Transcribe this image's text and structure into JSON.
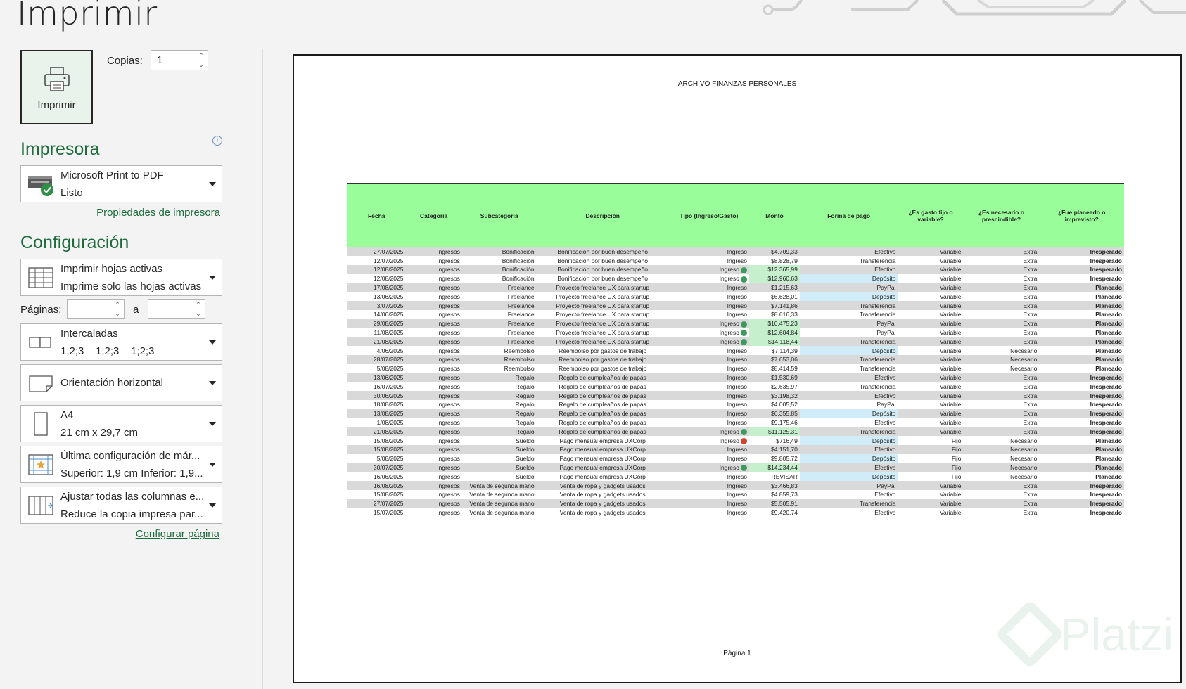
{
  "title": "Imprimir",
  "print_button": {
    "label": "Imprimir",
    "icon": "printer-icon"
  },
  "copies": {
    "label": "Copias:",
    "value": "1"
  },
  "printer_section": {
    "heading": "Impresora",
    "name": "Microsoft Print to PDF",
    "status": "Listo",
    "properties_link": "Propiedades de impresora"
  },
  "config_section": {
    "heading": "Configuración",
    "what": {
      "line1": "Imprimir hojas activas",
      "line2": "Imprime solo las hojas activas"
    },
    "pages_label": "Páginas:",
    "pages_to": "a",
    "pages_from_value": "",
    "pages_to_value": "",
    "collate": {
      "line1": "Intercaladas",
      "line2": "1;2;3    1;2;3    1;2;3"
    },
    "orientation": {
      "line1": "Orientación horizontal"
    },
    "paper": {
      "line1": "A4",
      "line2": "21 cm x 29,7 cm"
    },
    "margins": {
      "line1": "Última configuración de már...",
      "line2": "Superior: 1,9 cm Inferior: 1,9..."
    },
    "scaling": {
      "line1": "Ajustar todas las columnas e...",
      "line2": "Reduce la copia impresa par..."
    },
    "page_setup_link": "Configurar página"
  },
  "preview": {
    "doc_title": "ARCHIVO FINANZAS PERSONALES",
    "page_label": "Página 1",
    "columns": [
      "Fecha",
      "Categoría",
      "Subcategoría",
      "Descripción",
      "Tipo (Ingreso/Gasto)",
      "Monto",
      "Forma de pago",
      "¿Es gasto fijo o variable?",
      "¿Es necesario o prescindible?",
      "¿Fue planeado o imprevisto?"
    ],
    "rows": [
      {
        "fecha": "27/07/2025",
        "cat": "Ingresos",
        "sub": "Bonificación",
        "desc": "Bonificación por buen desempeño",
        "tipo": "Ingreso",
        "monto": "$4.709,33",
        "pago": "Efectivo",
        "fijo": "Variable",
        "nec": "Extra",
        "plan": "Inesperado",
        "status": "",
        "hl": ""
      },
      {
        "fecha": "12/07/2025",
        "cat": "Ingresos",
        "sub": "Bonificación",
        "desc": "Bonificación por buen desempeño",
        "tipo": "Ingreso",
        "monto": "$8.828,79",
        "pago": "Transferencia",
        "fijo": "Variable",
        "nec": "Extra",
        "plan": "Inesperado",
        "status": "",
        "hl": ""
      },
      {
        "fecha": "12/08/2025",
        "cat": "Ingresos",
        "sub": "Bonificación",
        "desc": "Bonificación por buen desempeño",
        "tipo": "Ingreso",
        "monto": "$12.365,99",
        "pago": "Efectivo",
        "fijo": "Variable",
        "nec": "Extra",
        "plan": "Inesperado",
        "status": "ok",
        "hl": "mg"
      },
      {
        "fecha": "12/08/2025",
        "cat": "Ingresos",
        "sub": "Bonificación",
        "desc": "Bonificación por buen desempeño",
        "tipo": "Ingreso",
        "monto": "$12.960,63",
        "pago": "Depósito",
        "fijo": "Variable",
        "nec": "Extra",
        "plan": "Inesperado",
        "status": "ok",
        "hl": "mg"
      },
      {
        "fecha": "17/08/2025",
        "cat": "Ingresos",
        "sub": "Freelance",
        "desc": "Proyecto freelance UX para startup",
        "tipo": "Ingreso",
        "monto": "$1.215,63",
        "pago": "PayPal",
        "fijo": "Variable",
        "nec": "Extra",
        "plan": "Planeado",
        "status": "",
        "hl": ""
      },
      {
        "fecha": "13/06/2025",
        "cat": "Ingresos",
        "sub": "Freelance",
        "desc": "Proyecto freelance UX para startup",
        "tipo": "Ingreso",
        "monto": "$6.628,01",
        "pago": "Depósito",
        "fijo": "Variable",
        "nec": "Extra",
        "plan": "Planeado",
        "status": "",
        "hl": ""
      },
      {
        "fecha": "3/07/2025",
        "cat": "Ingresos",
        "sub": "Freelance",
        "desc": "Proyecto freelance UX para startup",
        "tipo": "Ingreso",
        "monto": "$7.141,86",
        "pago": "Transferencia",
        "fijo": "Variable",
        "nec": "Extra",
        "plan": "Planeado",
        "status": "",
        "hl": ""
      },
      {
        "fecha": "14/06/2025",
        "cat": "Ingresos",
        "sub": "Freelance",
        "desc": "Proyecto freelance UX para startup",
        "tipo": "Ingreso",
        "monto": "$8.616,33",
        "pago": "Transferencia",
        "fijo": "Variable",
        "nec": "Extra",
        "plan": "Planeado",
        "status": "",
        "hl": ""
      },
      {
        "fecha": "29/08/2025",
        "cat": "Ingresos",
        "sub": "Freelance",
        "desc": "Proyecto freelance UX para startup",
        "tipo": "Ingreso",
        "monto": "$10.475,23",
        "pago": "PayPal",
        "fijo": "Variable",
        "nec": "Extra",
        "plan": "Planeado",
        "status": "ok",
        "hl": "mg"
      },
      {
        "fecha": "11/08/2025",
        "cat": "Ingresos",
        "sub": "Freelance",
        "desc": "Proyecto freelance UX para startup",
        "tipo": "Ingreso",
        "monto": "$12.604,84",
        "pago": "PayPal",
        "fijo": "Variable",
        "nec": "Extra",
        "plan": "Planeado",
        "status": "ok",
        "hl": "mg"
      },
      {
        "fecha": "21/08/2025",
        "cat": "Ingresos",
        "sub": "Freelance",
        "desc": "Proyecto freelance UX para startup",
        "tipo": "Ingreso",
        "monto": "$14.118,44",
        "pago": "Transferencia",
        "fijo": "Variable",
        "nec": "Extra",
        "plan": "Planeado",
        "status": "ok",
        "hl": "mg"
      },
      {
        "fecha": "4/06/2025",
        "cat": "Ingresos",
        "sub": "Reembolso",
        "desc": "Reembolso por gastos de trabajo",
        "tipo": "Ingreso",
        "monto": "$7.114,39",
        "pago": "Depósito",
        "fijo": "Variable",
        "nec": "Necesario",
        "plan": "Planeado",
        "status": "",
        "hl": ""
      },
      {
        "fecha": "28/07/2025",
        "cat": "Ingresos",
        "sub": "Reembolso",
        "desc": "Reembolso por gastos de trabajo",
        "tipo": "Ingreso",
        "monto": "$7.653,06",
        "pago": "Transferencia",
        "fijo": "Variable",
        "nec": "Necesario",
        "plan": "Planeado",
        "status": "",
        "hl": ""
      },
      {
        "fecha": "5/08/2025",
        "cat": "Ingresos",
        "sub": "Reembolso",
        "desc": "Reembolso por gastos de trabajo",
        "tipo": "Ingreso",
        "monto": "$8.414,59",
        "pago": "Transferencia",
        "fijo": "Variable",
        "nec": "Necesario",
        "plan": "Planeado",
        "status": "",
        "hl": ""
      },
      {
        "fecha": "13/06/2025",
        "cat": "Ingresos",
        "sub": "Regalo",
        "desc": "Regalo de cumpleaños de papás",
        "tipo": "Ingreso",
        "monto": "$1.530,69",
        "pago": "Efectivo",
        "fijo": "Variable",
        "nec": "Extra",
        "plan": "Inesperado",
        "status": "",
        "hl": ""
      },
      {
        "fecha": "16/07/2025",
        "cat": "Ingresos",
        "sub": "Regalo",
        "desc": "Regalo de cumpleaños de papás",
        "tipo": "Ingreso",
        "monto": "$2.635,97",
        "pago": "Transferencia",
        "fijo": "Variable",
        "nec": "Extra",
        "plan": "Inesperado",
        "status": "",
        "hl": ""
      },
      {
        "fecha": "30/06/2025",
        "cat": "Ingresos",
        "sub": "Regalo",
        "desc": "Regalo de cumpleaños de papás",
        "tipo": "Ingreso",
        "monto": "$3.198,32",
        "pago": "Efectivo",
        "fijo": "Variable",
        "nec": "Extra",
        "plan": "Inesperado",
        "status": "",
        "hl": ""
      },
      {
        "fecha": "18/08/2025",
        "cat": "Ingresos",
        "sub": "Regalo",
        "desc": "Regalo de cumpleaños de papás",
        "tipo": "Ingreso",
        "monto": "$4.005,52",
        "pago": "PayPal",
        "fijo": "Variable",
        "nec": "Extra",
        "plan": "Inesperado",
        "status": "",
        "hl": ""
      },
      {
        "fecha": "13/08/2025",
        "cat": "Ingresos",
        "sub": "Regalo",
        "desc": "Regalo de cumpleaños de papás",
        "tipo": "Ingreso",
        "monto": "$6.355,85",
        "pago": "Depósito",
        "fijo": "Variable",
        "nec": "Extra",
        "plan": "Inesperado",
        "status": "",
        "hl": ""
      },
      {
        "fecha": "1/08/2025",
        "cat": "Ingresos",
        "sub": "Regalo",
        "desc": "Regalo de cumpleaños de papás",
        "tipo": "Ingreso",
        "monto": "$9.175,46",
        "pago": "Efectivo",
        "fijo": "Variable",
        "nec": "Extra",
        "plan": "Inesperado",
        "status": "",
        "hl": ""
      },
      {
        "fecha": "21/08/2025",
        "cat": "Ingresos",
        "sub": "Regalo",
        "desc": "Regalo de cumpleaños de papás",
        "tipo": "Ingreso",
        "monto": "$11.125,31",
        "pago": "Transferencia",
        "fijo": "Variable",
        "nec": "Extra",
        "plan": "Inesperado",
        "status": "ok",
        "hl": "mg"
      },
      {
        "fecha": "15/08/2025",
        "cat": "Ingresos",
        "sub": "Sueldo",
        "desc": "Pago mensual empresa UXCorp",
        "tipo": "Ingreso",
        "monto": "$716,49",
        "pago": "Depósito",
        "fijo": "Fijo",
        "nec": "Necesario",
        "plan": "Planeado",
        "status": "bad",
        "hl": ""
      },
      {
        "fecha": "15/08/2025",
        "cat": "Ingresos",
        "sub": "Sueldo",
        "desc": "Pago mensual empresa UXCorp",
        "tipo": "Ingreso",
        "monto": "$4.151,70",
        "pago": "Efectivo",
        "fijo": "Fijo",
        "nec": "Necesario",
        "plan": "Planeado",
        "status": "",
        "hl": ""
      },
      {
        "fecha": "5/08/2025",
        "cat": "Ingresos",
        "sub": "Sueldo",
        "desc": "Pago mensual empresa UXCorp",
        "tipo": "Ingreso",
        "monto": "$9.805,72",
        "pago": "Depósito",
        "fijo": "Fijo",
        "nec": "Necesario",
        "plan": "Planeado",
        "status": "",
        "hl": ""
      },
      {
        "fecha": "30/07/2025",
        "cat": "Ingresos",
        "sub": "Sueldo",
        "desc": "Pago mensual empresa UXCorp",
        "tipo": "Ingreso",
        "monto": "$14.234,44",
        "pago": "Efectivo",
        "fijo": "Fijo",
        "nec": "Necesario",
        "plan": "Planeado",
        "status": "ok",
        "hl": "mg"
      },
      {
        "fecha": "16/06/2025",
        "cat": "Ingresos",
        "sub": "Sueldo",
        "desc": "Pago mensual empresa UXCorp",
        "tipo": "Ingreso",
        "monto": "REVISAR",
        "pago": "Depósito",
        "fijo": "Fijo",
        "nec": "Necesario",
        "plan": "Planeado",
        "status": "",
        "hl": ""
      },
      {
        "fecha": "16/08/2025",
        "cat": "Ingresos",
        "sub": "Venta de segunda mano",
        "desc": "Venta de ropa y gadgets usados",
        "tipo": "Ingreso",
        "monto": "$3.466,83",
        "pago": "PayPal",
        "fijo": "Variable",
        "nec": "Extra",
        "plan": "Inesperado",
        "status": "",
        "hl": ""
      },
      {
        "fecha": "15/08/2025",
        "cat": "Ingresos",
        "sub": "Venta de segunda mano",
        "desc": "Venta de ropa y gadgets usados",
        "tipo": "Ingreso",
        "monto": "$4.859,73",
        "pago": "Efectivo",
        "fijo": "Variable",
        "nec": "Extra",
        "plan": "Inesperado",
        "status": "",
        "hl": ""
      },
      {
        "fecha": "27/07/2025",
        "cat": "Ingresos",
        "sub": "Venta de segunda mano",
        "desc": "Venta de ropa y gadgets usados",
        "tipo": "Ingreso",
        "monto": "$5.505,91",
        "pago": "Transferencia",
        "fijo": "Variable",
        "nec": "Extra",
        "plan": "Inesperado",
        "status": "",
        "hl": ""
      },
      {
        "fecha": "15/07/2025",
        "cat": "Ingresos",
        "sub": "Venta de segunda mano",
        "desc": "Venta de ropa y gadgets usados",
        "tipo": "Ingreso",
        "monto": "$9.420,74",
        "pago": "Efectivo",
        "fijo": "Variable",
        "nec": "Extra",
        "plan": "Inesperado",
        "status": "",
        "hl": ""
      }
    ]
  },
  "watermark": "Platzi",
  "colors": {
    "accent": "#1e6b3c",
    "header_fill": "#99fe99",
    "highlight_green": "#c6efce",
    "highlight_blue": "#d0ecf9"
  }
}
